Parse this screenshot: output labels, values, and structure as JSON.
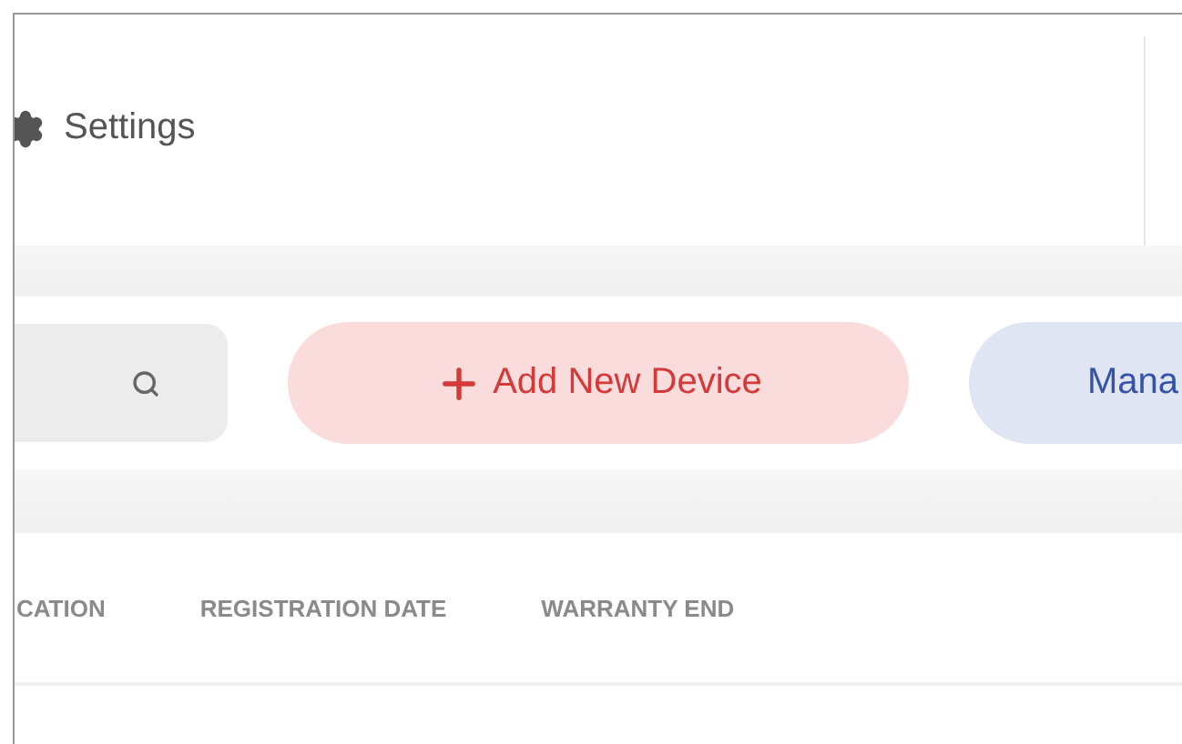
{
  "header": {
    "settings_link": {
      "label": "Settings"
    }
  },
  "toolbar": {
    "buttons": [
      {
        "label": "Add New Device",
        "kind": "add"
      },
      {
        "label": "Mana",
        "kind": "manage"
      }
    ]
  },
  "table": {
    "columns": [
      "CATION",
      "REGISTRATION DATE",
      "WARRANTY END"
    ]
  }
}
